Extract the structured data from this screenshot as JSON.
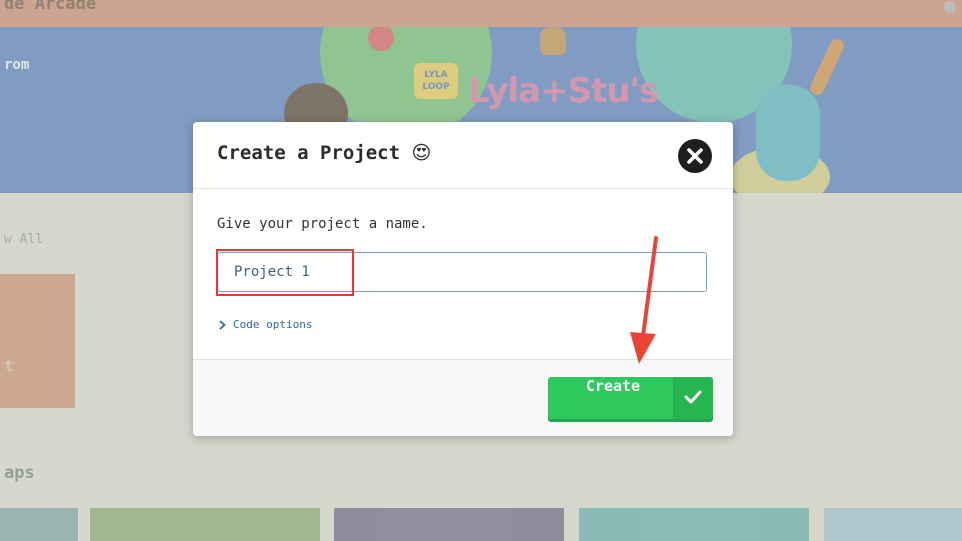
{
  "background": {
    "top_title": "de Arcade",
    "hero_from": "rom",
    "hero_logo_small": "LYLA LOOP",
    "hero_logo": "Lyla+Stu's",
    "view_all": "w All",
    "card_label": "t",
    "maps_heading": "aps"
  },
  "dialog": {
    "title": "Create a Project",
    "title_emoji": "😍",
    "prompt": "Give your project a name.",
    "name_value": "Project 1",
    "code_options_label": "Code options",
    "create_label": "Create"
  },
  "colors": {
    "create_button": "#2ec95c",
    "highlight": "#e23b3b",
    "arrow": "#ea4335"
  },
  "icons": {
    "close": "close-icon",
    "check": "check-icon",
    "chevron": "chevron-right-icon"
  }
}
